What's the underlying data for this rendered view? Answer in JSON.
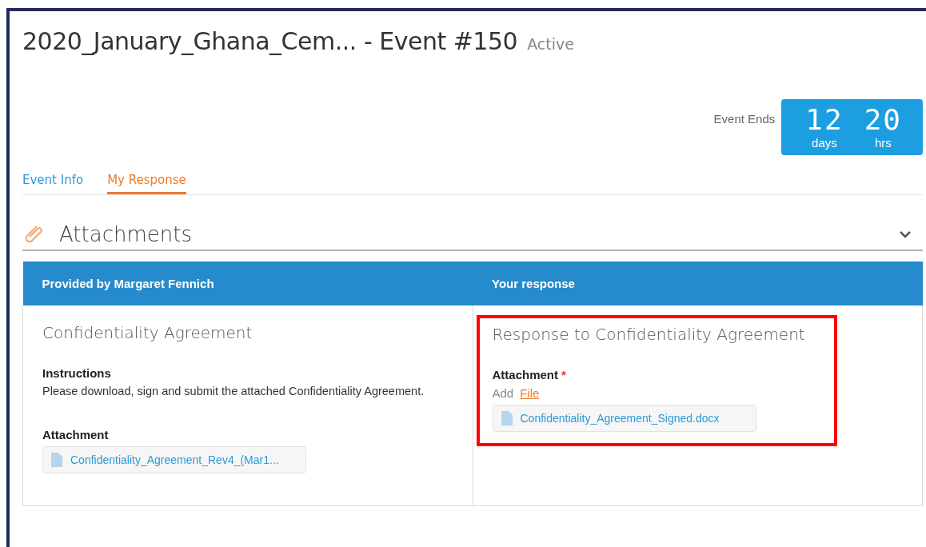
{
  "header": {
    "title": "2020_January_Ghana_Cem... - Event #150",
    "status": "Active"
  },
  "countdown": {
    "label": "Event Ends",
    "units": [
      {
        "value": "12",
        "unit": "days"
      },
      {
        "value": "20",
        "unit": "hrs"
      }
    ]
  },
  "tabs": [
    {
      "label": "Event Info",
      "selected": false
    },
    {
      "label": "My Response",
      "selected": true
    }
  ],
  "section": {
    "title": "Attachments",
    "expanded": true
  },
  "table": {
    "columns": [
      "Provided by Margaret Fennich",
      "Your response"
    ],
    "provided": {
      "title": "Confidentiality Agreement",
      "instructions_label": "Instructions",
      "instructions": "Please download, sign and submit the attached Confidentiality Agreement.",
      "attachment_label": "Attachment",
      "file": "Confidentiality_Agreement_Rev4_(Mar1..."
    },
    "response": {
      "title": "Response to Confidentiality Agreement",
      "highlighted": true,
      "attachment_label": "Attachment",
      "required_mark": "*",
      "add_label": "Add",
      "add_link": "File",
      "file": "Confidentiality_Agreement_Signed.docx"
    }
  }
}
